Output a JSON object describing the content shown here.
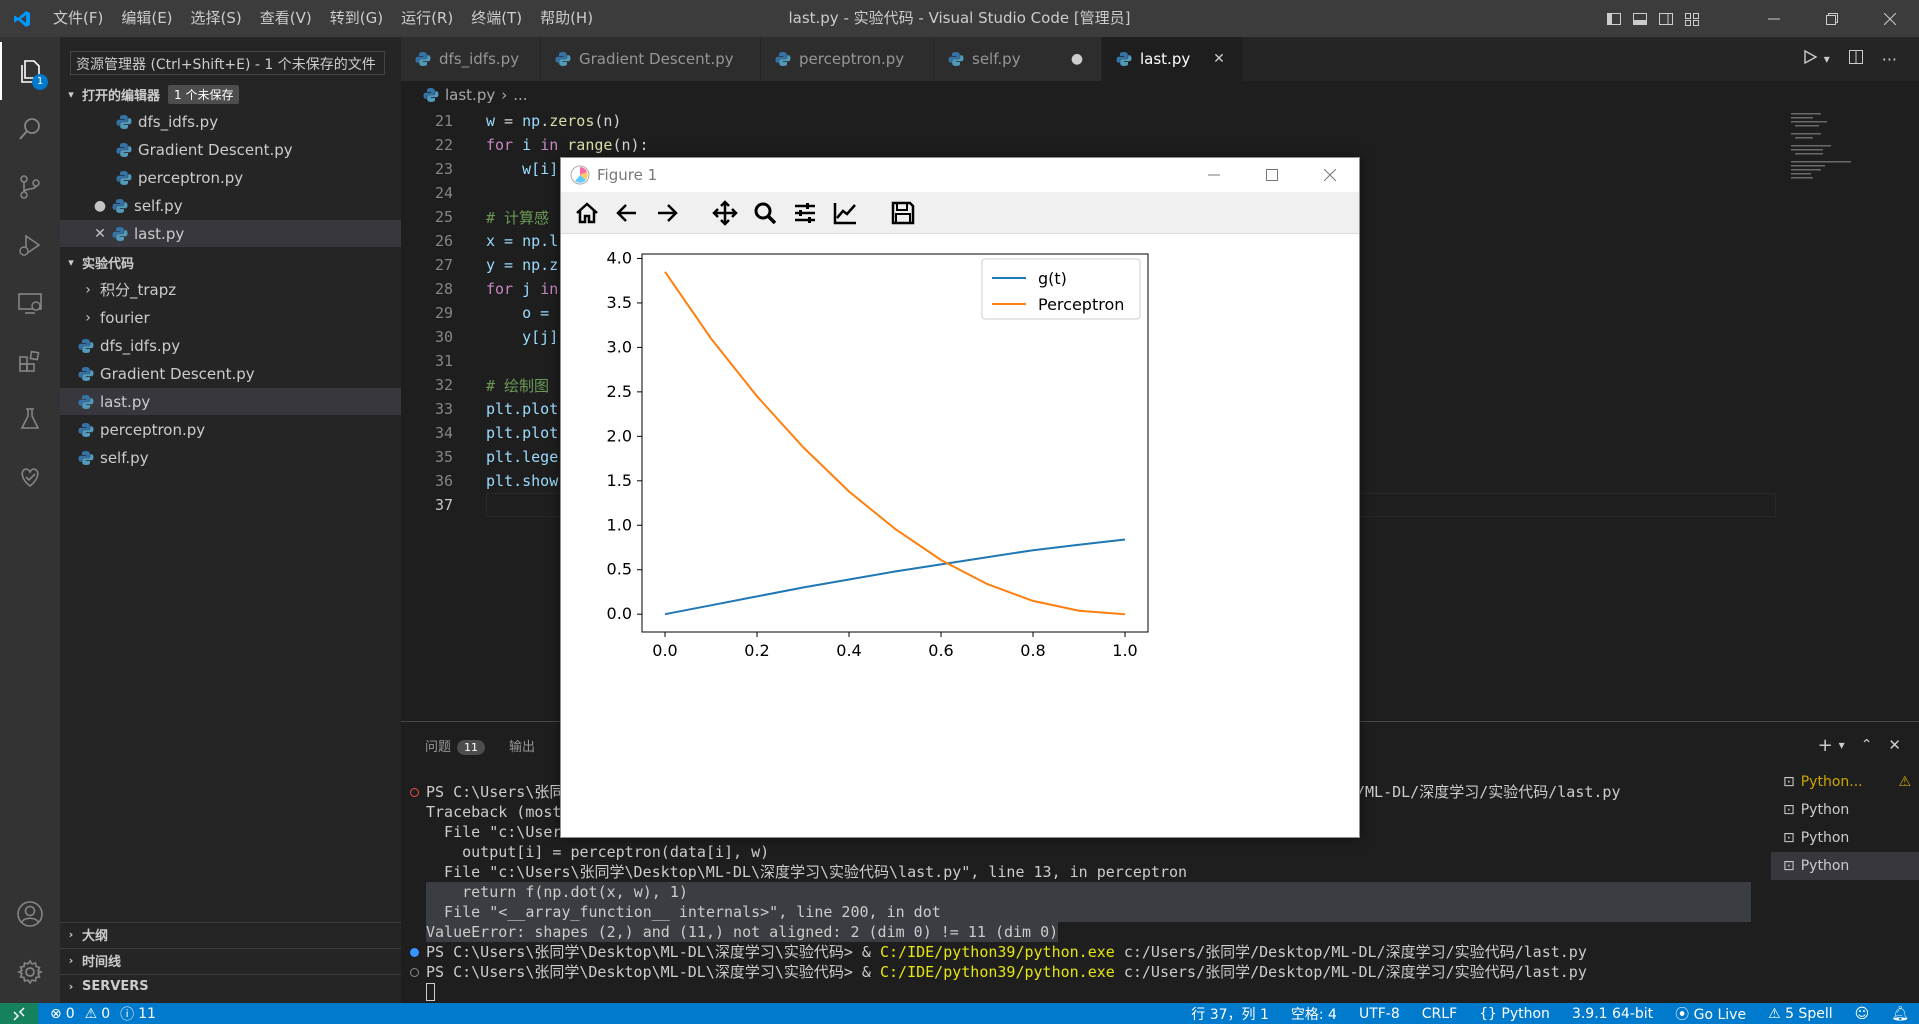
{
  "window": {
    "title": "last.py - 实验代码 - Visual Studio Code [管理员]",
    "menu": [
      "文件(F)",
      "编辑(E)",
      "选择(S)",
      "查看(V)",
      "转到(G)",
      "运行(R)",
      "终端(T)",
      "帮助(H)"
    ]
  },
  "activity": {
    "explorer_badge": "1"
  },
  "sidebar": {
    "tooltip": "资源管理器 (Ctrl+Shift+E) - 1 个未保存的文件",
    "open_editors": {
      "title": "打开的编辑器",
      "badge": "1 个未保存",
      "items": [
        "dfs_idfs.py",
        "Gradient Descent.py",
        "perceptron.py",
        "self.py",
        "last.py"
      ]
    },
    "folder": {
      "title": "实验代码",
      "subfolders": [
        "积分_trapz",
        "fourier"
      ],
      "files": [
        "dfs_idfs.py",
        "Gradient Descent.py",
        "last.py",
        "perceptron.py",
        "self.py"
      ]
    },
    "bottom_sections": [
      "大纲",
      "时间线",
      "SERVERS"
    ]
  },
  "tabs": [
    "dfs_idfs.py",
    "Gradient Descent.py",
    "perceptron.py",
    "self.py",
    "last.py"
  ],
  "breadcrumb": {
    "file": "last.py",
    "rest": "..."
  },
  "code": {
    "line_numbers": [
      "21",
      "22",
      "23",
      "24",
      "25",
      "26",
      "27",
      "28",
      "29",
      "30",
      "31",
      "32",
      "33",
      "34",
      "35",
      "36",
      "37"
    ],
    "l21": [
      "w",
      " = ",
      "np",
      ".",
      "zeros",
      "(n)"
    ],
    "l22": [
      "for",
      " i ",
      "in",
      " ",
      "range",
      "(n):"
    ],
    "l23": "    w[i]",
    "l25": "# 计算感",
    "l26": "x = np.l",
    "l27": "y = np.z",
    "l28": [
      "for",
      " j ",
      "in"
    ],
    "l29": "    o = ",
    "l30": "    y[j]",
    "l32": "# 绘制图",
    "l33": "plt.plot",
    "l34": "plt.plot",
    "l35": "plt.lege",
    "l36": "plt.show"
  },
  "panel": {
    "tabs": [
      "问题",
      "输出"
    ],
    "problems_count": "11",
    "terminal_lines": [
      "PS C:\\Users\\张同",
      "Traceback (most",
      "  File \"c:\\User",
      "    output[i] = perceptron(data[i], w)",
      "  File \"c:\\Users\\张同学\\Desktop\\ML-DL\\深度学习\\实验代码\\last.py\", line 13, in perceptron",
      "    return f(np.dot(x, w), 1)",
      "  File \"<__array_function__ internals>\", line 200, in dot",
      "ValueError: shapes (2,) and (11,) not aligned: 2 (dim 0) != 11 (dim 0)"
    ],
    "line1_tail": "/ML-DL/深度学习/实验代码/last.py",
    "prompt": "PS C:\\Users\\张同学\\Desktop\\ML-DL\\深度学习\\实验代码> & ",
    "exe": "C:/IDE/python39/python.exe",
    "script": " c:/Users/张同学/Desktop/ML-DL/深度学习/实验代码/last.py",
    "terminals": [
      "Python...",
      "Python",
      "Python",
      "Python"
    ]
  },
  "status": {
    "errors": "0",
    "warnings": "0",
    "infos": "11",
    "position": "行 37，列 1",
    "spaces": "空格: 4",
    "encoding": "UTF-8",
    "eol": "CRLF",
    "language": "Python",
    "interpreter": "3.9.1 64-bit",
    "golive": "Go Live",
    "spell": "5 Spell"
  },
  "figure": {
    "title": "Figure 1",
    "toolbar": [
      "home-icon",
      "back-icon",
      "forward-icon",
      "pan-icon",
      "zoom-icon",
      "configure-icon",
      "edit-axis-icon",
      "save-icon"
    ]
  },
  "chart_data": {
    "type": "line",
    "title": "",
    "xlabel": "",
    "ylabel": "",
    "xlim": [
      -0.05,
      1.05
    ],
    "ylim": [
      -0.2,
      4.05
    ],
    "xticks": [
      "0.0",
      "0.2",
      "0.4",
      "0.6",
      "0.8",
      "1.0"
    ],
    "yticks": [
      "0.0",
      "0.5",
      "1.0",
      "1.5",
      "2.0",
      "2.5",
      "3.0",
      "3.5",
      "4.0"
    ],
    "legend_position": "top-right",
    "grid": false,
    "series": [
      {
        "name": "g(t)",
        "color": "#1f77b4",
        "x": [
          0.0,
          0.1,
          0.2,
          0.3,
          0.4,
          0.5,
          0.6,
          0.7,
          0.8,
          0.9,
          1.0
        ],
        "y": [
          0.0,
          0.1,
          0.2,
          0.3,
          0.39,
          0.48,
          0.56,
          0.64,
          0.72,
          0.78,
          0.84
        ]
      },
      {
        "name": "Perceptron",
        "color": "#ff7f0e",
        "x": [
          0.0,
          0.1,
          0.2,
          0.3,
          0.4,
          0.5,
          0.6,
          0.7,
          0.8,
          0.9,
          1.0
        ],
        "y": [
          3.85,
          3.1,
          2.45,
          1.88,
          1.38,
          0.96,
          0.61,
          0.34,
          0.15,
          0.04,
          0.0
        ]
      }
    ]
  }
}
